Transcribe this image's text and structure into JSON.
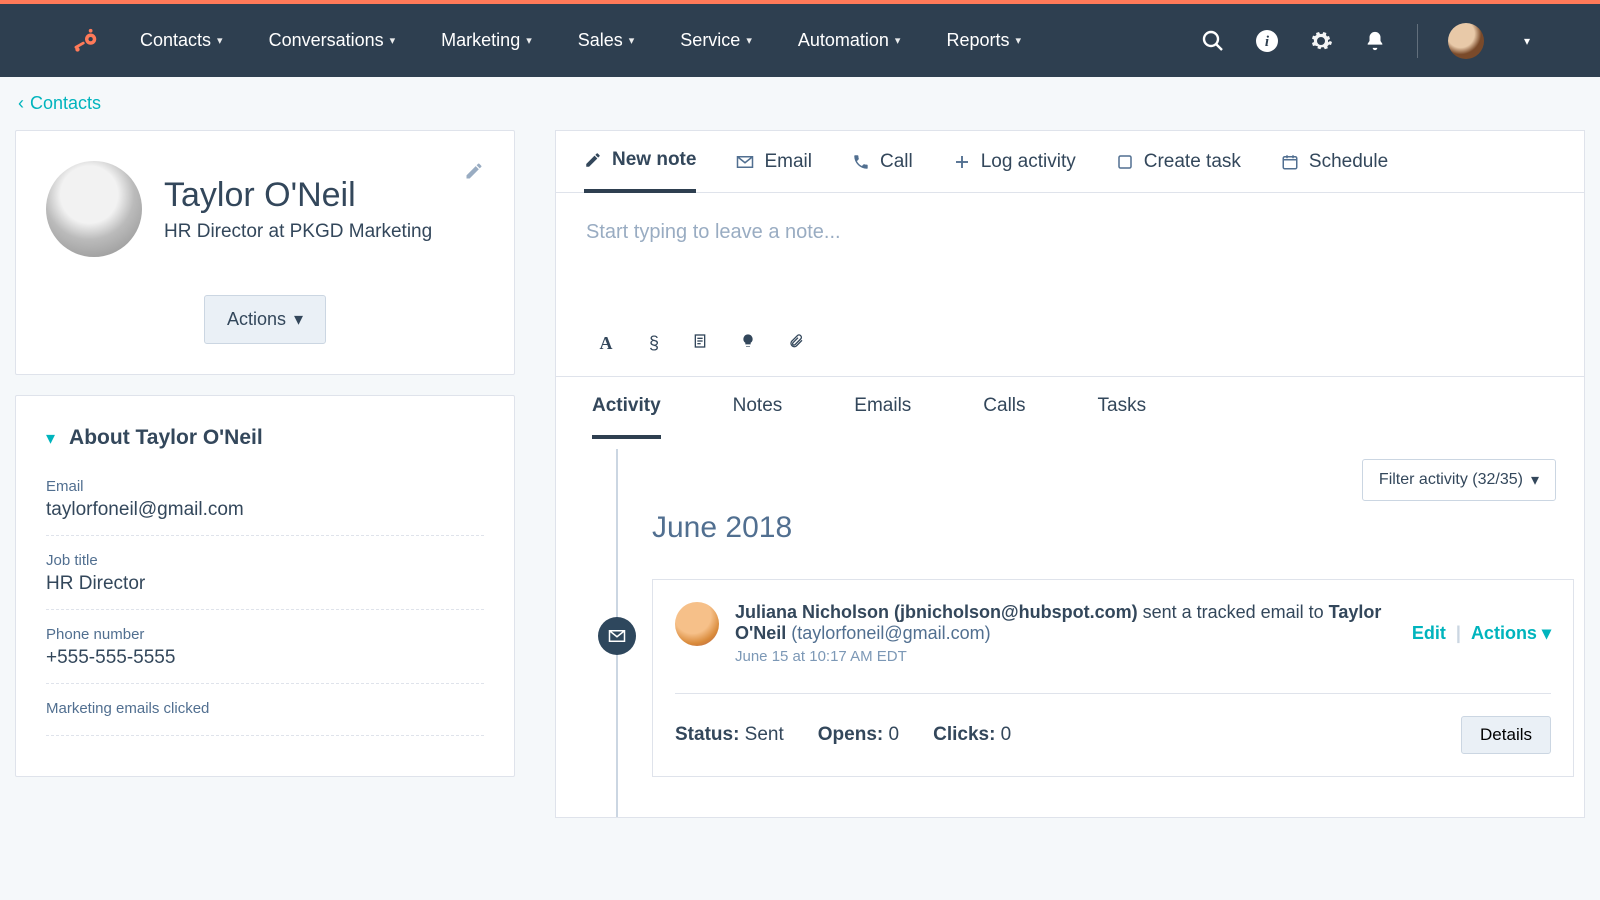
{
  "nav": {
    "items": [
      "Contacts",
      "Conversations",
      "Marketing",
      "Sales",
      "Service",
      "Automation",
      "Reports"
    ]
  },
  "breadcrumb": {
    "label": "Contacts"
  },
  "profile": {
    "name": "Taylor O'Neil",
    "subtitle": "HR Director at PKGD Marketing",
    "actions_label": "Actions"
  },
  "about": {
    "title": "About Taylor O'Neil",
    "fields": [
      {
        "label": "Email",
        "value": "taylorfoneil@gmail.com"
      },
      {
        "label": "Job title",
        "value": "HR Director"
      },
      {
        "label": "Phone number",
        "value": "+555-555-5555"
      },
      {
        "label": "Marketing emails clicked",
        "value": ""
      }
    ]
  },
  "compose": {
    "tabs": [
      "New note",
      "Email",
      "Call",
      "Log activity",
      "Create task",
      "Schedule"
    ],
    "placeholder": "Start typing to leave a note..."
  },
  "activity_tabs": [
    "Activity",
    "Notes",
    "Emails",
    "Calls",
    "Tasks"
  ],
  "filter": {
    "label": "Filter activity (32/35)"
  },
  "timeline": {
    "month": "June 2018",
    "event": {
      "sender_name": "Juliana Nicholson",
      "sender_email": "(jbnicholson@hubspot.com)",
      "mid": " sent a tracked email to ",
      "recipient_name": "Taylor O'Neil",
      "recipient_email": " (taylorfoneil@gmail.com)",
      "date": "June 15 at 10:17 AM EDT",
      "edit": "Edit",
      "actions": "Actions",
      "status_label": "Status:",
      "status_value": " Sent",
      "opens_label": "Opens:",
      "opens_value": " 0",
      "clicks_label": "Clicks:",
      "clicks_value": " 0",
      "details": "Details"
    }
  }
}
